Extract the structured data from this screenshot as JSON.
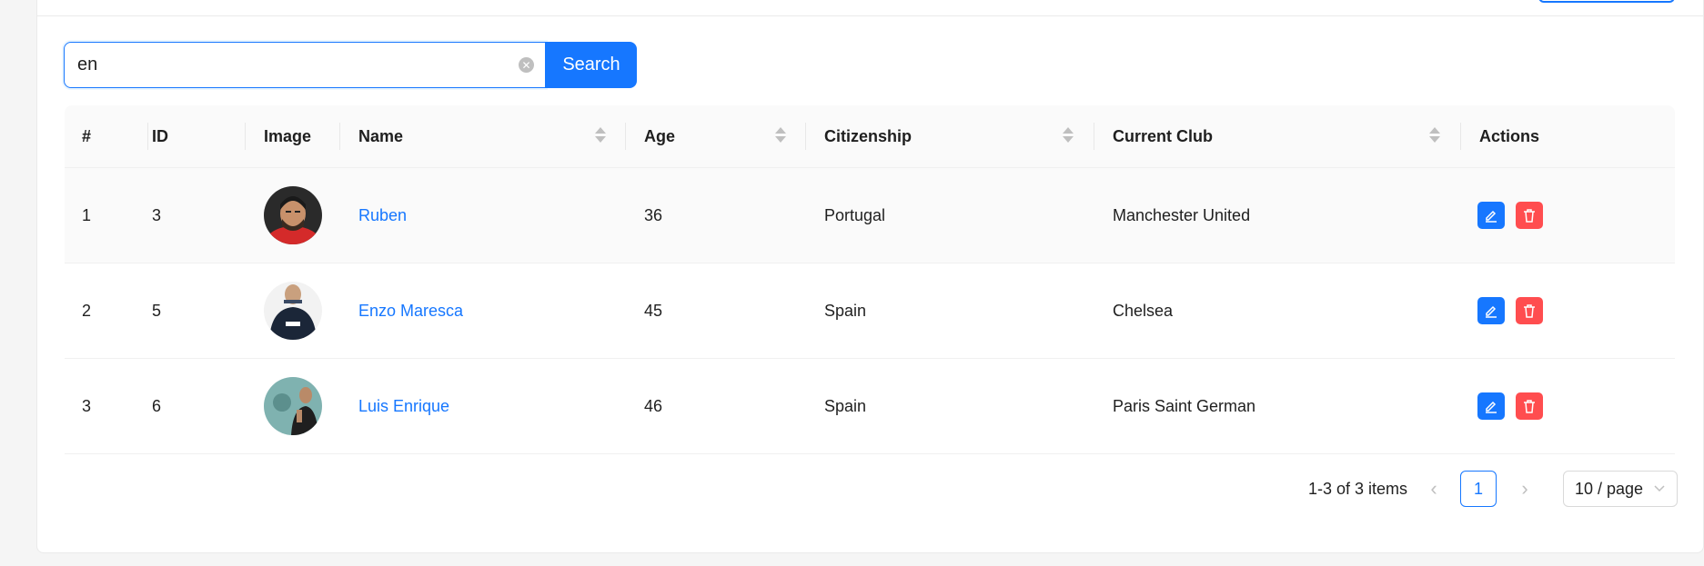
{
  "search": {
    "value": "en",
    "button_label": "Search"
  },
  "table": {
    "columns": {
      "index": "#",
      "id": "ID",
      "image": "Image",
      "name": "Name",
      "age": "Age",
      "citizenship": "Citizenship",
      "current_club": "Current Club",
      "actions": "Actions"
    },
    "rows": [
      {
        "index": "1",
        "id": "3",
        "name": "Ruben",
        "age": "36",
        "citizenship": "Portugal",
        "current_club": "Manchester United"
      },
      {
        "index": "2",
        "id": "5",
        "name": "Enzo Maresca",
        "age": "45",
        "citizenship": "Spain",
        "current_club": "Chelsea"
      },
      {
        "index": "3",
        "id": "6",
        "name": "Luis Enrique",
        "age": "46",
        "citizenship": "Spain",
        "current_club": "Paris Saint German"
      }
    ]
  },
  "pagination": {
    "total_text": "1-3 of 3 items",
    "current_page": "1",
    "page_size": "10 / page"
  },
  "icons": {
    "clear": "close-circle-icon",
    "edit": "edit-icon",
    "delete": "delete-icon",
    "prev": "chevron-left-icon",
    "next": "chevron-right-icon",
    "dropdown": "chevron-down-icon",
    "sort": "sort-icon"
  },
  "colors": {
    "primary": "#1677ff",
    "danger": "#ff4d4f"
  }
}
